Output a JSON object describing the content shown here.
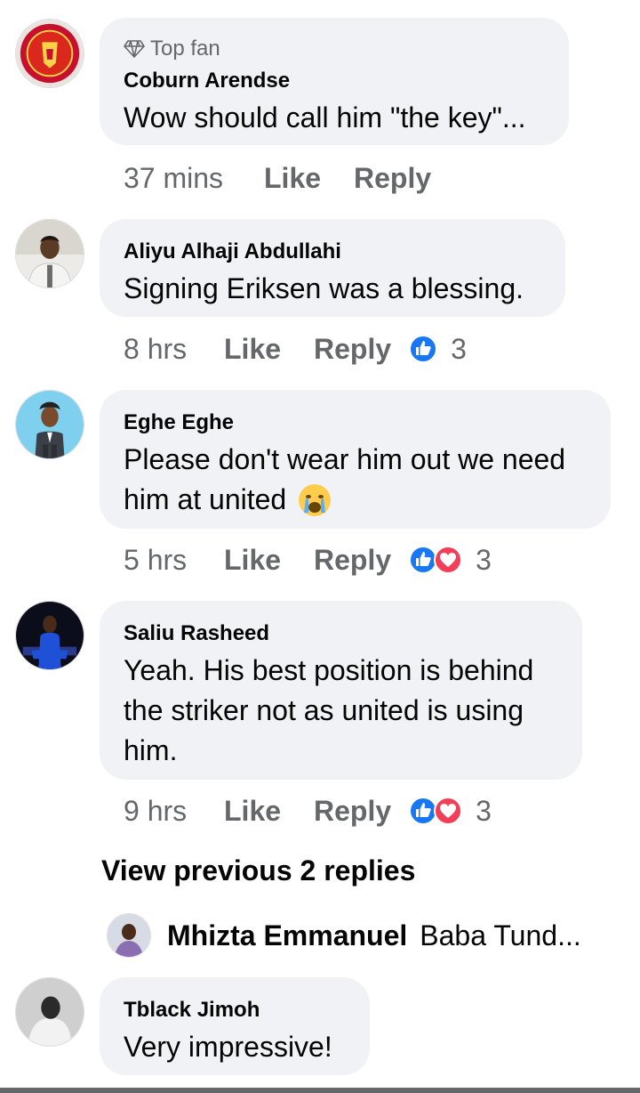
{
  "comments": [
    {
      "badge": "Top fan",
      "name": "Coburn Arendse",
      "text": "Wow should call him \"the key\"...",
      "time": "37 mins",
      "like": "Like",
      "reply": "Reply"
    },
    {
      "name": "Aliyu Alhaji Abdullahi",
      "text": "Signing Eriksen was a blessing.",
      "time": "8 hrs",
      "like": "Like",
      "reply": "Reply",
      "reaction_count": "3"
    },
    {
      "name": "Eghe Eghe",
      "text_lines": [
        "Please don't wear him out we need",
        "him at united"
      ],
      "emoji": "crying-face",
      "time": "5 hrs",
      "like": "Like",
      "reply": "Reply",
      "reaction_count": "3"
    },
    {
      "name": "Saliu Rasheed",
      "text_lines": [
        "Yeah. His best position is behind",
        "the striker not as united is using",
        "him."
      ],
      "time": "9 hrs",
      "like": "Like",
      "reply": "Reply",
      "reaction_count": "3"
    },
    {
      "name": "Tblack Jimoh",
      "text": "Very impressive!"
    }
  ],
  "view_previous": "View previous 2 replies",
  "latest_reply": {
    "name": "Mhizta Emmanuel",
    "text": "Baba Tund..."
  },
  "colors": {
    "bubble": "#f0f2f5",
    "meta": "#65676b",
    "like_blue": "#1877f2",
    "love_red": "#f33e58"
  }
}
